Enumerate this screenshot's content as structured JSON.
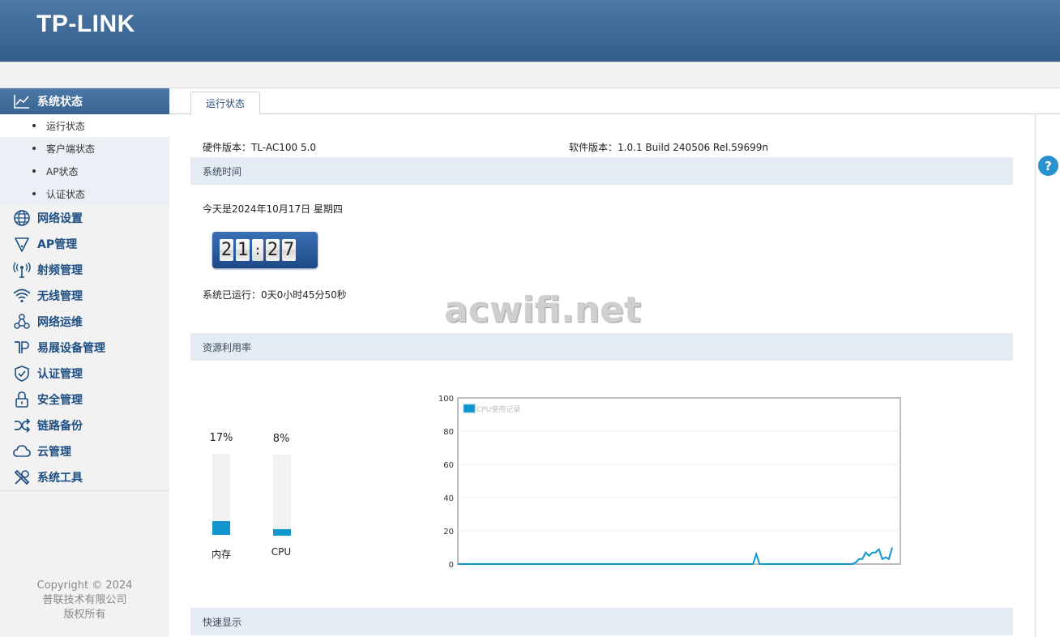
{
  "header": {
    "logo": "TP-LINK"
  },
  "sidebar": {
    "section": {
      "label": "系统状态"
    },
    "sub_items": [
      {
        "label": "运行状态",
        "active": true
      },
      {
        "label": "客户端状态",
        "active": false
      },
      {
        "label": "AP状态",
        "active": false
      },
      {
        "label": "认证状态",
        "active": false
      }
    ],
    "menu": [
      {
        "label": "网络设置",
        "icon": "globe-icon"
      },
      {
        "label": "AP管理",
        "icon": "ap-icon"
      },
      {
        "label": "射频管理",
        "icon": "antenna-icon"
      },
      {
        "label": "无线管理",
        "icon": "wifi-icon"
      },
      {
        "label": "网络运维",
        "icon": "network-nodes-icon"
      },
      {
        "label": "易展设备管理",
        "icon": "easy-mesh-icon"
      },
      {
        "label": "认证管理",
        "icon": "shield-check-icon"
      },
      {
        "label": "安全管理",
        "icon": "lock-icon"
      },
      {
        "label": "链路备份",
        "icon": "shuffle-icon"
      },
      {
        "label": "云管理",
        "icon": "cloud-icon"
      },
      {
        "label": "系统工具",
        "icon": "tools-icon"
      }
    ],
    "copyright": [
      "Copyright © 2024",
      "普联技术有限公司",
      "版权所有"
    ]
  },
  "main": {
    "tab": "运行状态",
    "hardware_version": "硬件版本：TL-AC100 5.0",
    "software_version": "软件版本：1.0.1 Build 240506 Rel.59699n",
    "system_time_section": "系统时间",
    "date_text": "今天是2024年10月17日 星期四",
    "clock": {
      "digits": [
        "2",
        "1",
        "2",
        "7"
      ],
      "separator": ":"
    },
    "uptime_text": "系统已运行：0天0小时45分50秒",
    "watermark": "acwifi.net",
    "resource_section": "资源利用率",
    "resources": [
      {
        "label": "内存",
        "percent_text": "17%",
        "value": 17
      },
      {
        "label": "CPU",
        "percent_text": "8%",
        "value": 8
      }
    ],
    "quick_section": "快速显示"
  },
  "colors": {
    "accent": "#1196cf",
    "header": "#3e6896",
    "menu_text": "#1f4f82",
    "help": "#2a93cf"
  },
  "chart_data": {
    "type": "line",
    "legend": "CPU使用记录",
    "legend_position": "top-left",
    "ylim": [
      0,
      100
    ],
    "yticks": [
      0,
      20,
      40,
      60,
      80,
      100
    ],
    "grid": true,
    "series": [
      {
        "name": "CPU使用记录",
        "values": [
          0,
          0,
          0,
          0,
          0,
          0,
          0,
          0,
          0,
          0,
          0,
          0,
          0,
          0,
          0,
          0,
          0,
          0,
          0,
          0,
          0,
          0,
          0,
          0,
          0,
          0,
          0,
          0,
          0,
          0,
          0,
          0,
          0,
          0,
          0,
          0,
          0,
          0,
          0,
          0,
          0,
          0,
          0,
          0,
          0,
          0,
          0,
          0,
          0,
          0,
          0,
          0,
          0,
          0,
          0,
          0,
          0,
          0,
          0,
          0,
          0,
          0,
          0,
          0,
          0,
          0,
          0,
          0,
          0,
          0,
          0,
          0,
          0,
          0,
          0,
          0,
          0,
          0,
          0,
          0,
          0,
          0,
          0,
          0,
          0,
          0,
          0,
          0,
          0,
          0,
          6,
          0,
          0,
          0,
          0,
          0,
          0,
          0,
          0,
          0,
          0,
          0,
          0,
          0,
          0,
          0,
          0,
          0,
          0,
          0,
          0,
          0,
          0,
          0,
          0,
          0,
          0,
          0,
          0,
          0,
          1,
          3,
          3,
          7,
          5,
          7,
          7,
          9,
          3,
          4,
          3,
          10
        ]
      }
    ]
  }
}
